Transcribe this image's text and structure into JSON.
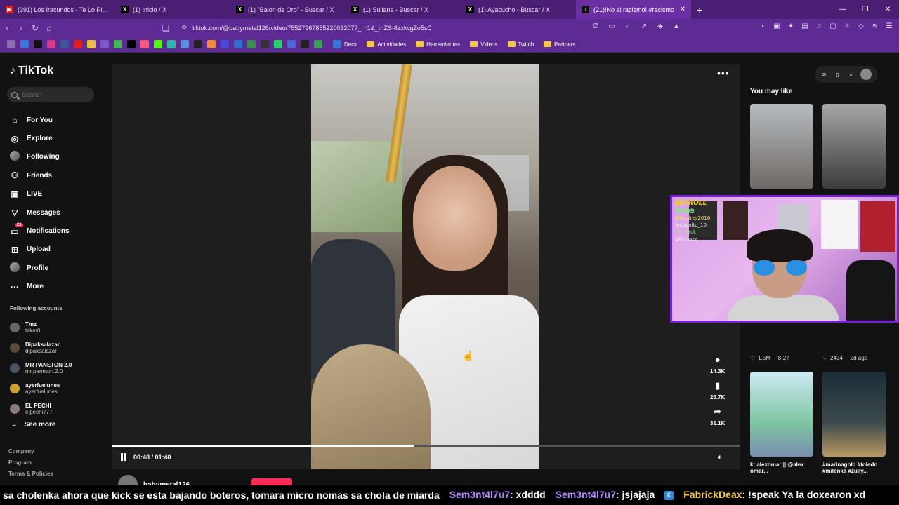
{
  "browser": {
    "tabs": [
      {
        "title": "(391) Los Iracundos - Te Lo Pido de F",
        "icon": "youtube-icon"
      },
      {
        "title": "(1) Inicio / X",
        "icon": "x-icon"
      },
      {
        "title": "(1) \"Balon de Oro\" - Buscar / X",
        "icon": "x-icon"
      },
      {
        "title": "(1) Sullana - Buscar / X",
        "icon": "x-icon"
      },
      {
        "title": "(1) Ayacucho - Buscar / X",
        "icon": "x-icon"
      },
      {
        "title": "(21)!No al racismo! #racismo",
        "icon": "tiktok-icon"
      }
    ],
    "url": "tiktok.com/@babymetal126/video/7552796785522003207?_r=1&_t=ZS-8zxlwgZo5sC",
    "bookmarks": [
      "Deck",
      "Actividades",
      "Herramientas",
      "Videos",
      "Twitch",
      "Partners"
    ],
    "colors": {
      "tabbar": "#4a1f73",
      "addrbar": "#5e2a93"
    }
  },
  "tiktok": {
    "logo": "TikTok",
    "search_placeholder": "Search",
    "nav": [
      {
        "label": "For You",
        "icon": "home-icon"
      },
      {
        "label": "Explore",
        "icon": "compass-icon"
      },
      {
        "label": "Following",
        "icon": "following-avatar-icon"
      },
      {
        "label": "Friends",
        "icon": "friends-icon"
      },
      {
        "label": "LIVE",
        "icon": "live-icon"
      },
      {
        "label": "Messages",
        "icon": "messages-icon"
      },
      {
        "label": "Notifications",
        "icon": "notifications-icon",
        "badge": "21"
      },
      {
        "label": "Upload",
        "icon": "upload-icon"
      },
      {
        "label": "Profile",
        "icon": "profile-icon"
      },
      {
        "label": "More",
        "icon": "more-icon"
      }
    ],
    "following_header": "Following accounts",
    "accounts": [
      {
        "name": "Tmz",
        "handle": "tzkm0"
      },
      {
        "name": "Dipaksalazar",
        "handle": "dipaksalazar"
      },
      {
        "name": "MR PANETON 2.0",
        "handle": "mr.paneton.2.0"
      },
      {
        "name": "ayerfuelunes",
        "handle": "ayerfuelunes"
      },
      {
        "name": "EL PECHI",
        "handle": "elpechi777"
      }
    ],
    "see_more": "See more",
    "footer": [
      "Company",
      "Program",
      "Terms & Policies"
    ],
    "video": {
      "time": "00:48 / 01:40",
      "progress": 0.48,
      "comments": "14.3K",
      "saves": "26.7K",
      "shares": "31.1K",
      "author": "babymetal126"
    },
    "right": {
      "you_may_like": "You may like",
      "items": [
        {
          "likes": "1.5M",
          "date": "8-27",
          "caption": "k: alexomar || @alex omar..."
        },
        {
          "likes": "2434",
          "date": "2d ago",
          "caption": "#marinagold #toledo #milenka #zully..."
        }
      ]
    },
    "accent": "#fe2c55"
  },
  "stream_overlay": {
    "board_title": "BETROLL",
    "board_subs": "Subs",
    "board_names": [
      "elmadres2016",
      "Incognito_10",
      "Yailblack",
      "g7emazz"
    ],
    "border_color": "#7a1dd8"
  },
  "chat": [
    {
      "text": "sa cholenka ahora que kick se esta bajando boteros, tomara micro nomas sa chola de miarda"
    },
    {
      "user": "Sem3nt4l7u7",
      "text": ": xdddd"
    },
    {
      "user": "Sem3nt4l7u7",
      "text": ": jsjajaja"
    },
    {
      "user": "FabrickDeax",
      "text": ": !speak Ya la doxearon xd"
    }
  ]
}
